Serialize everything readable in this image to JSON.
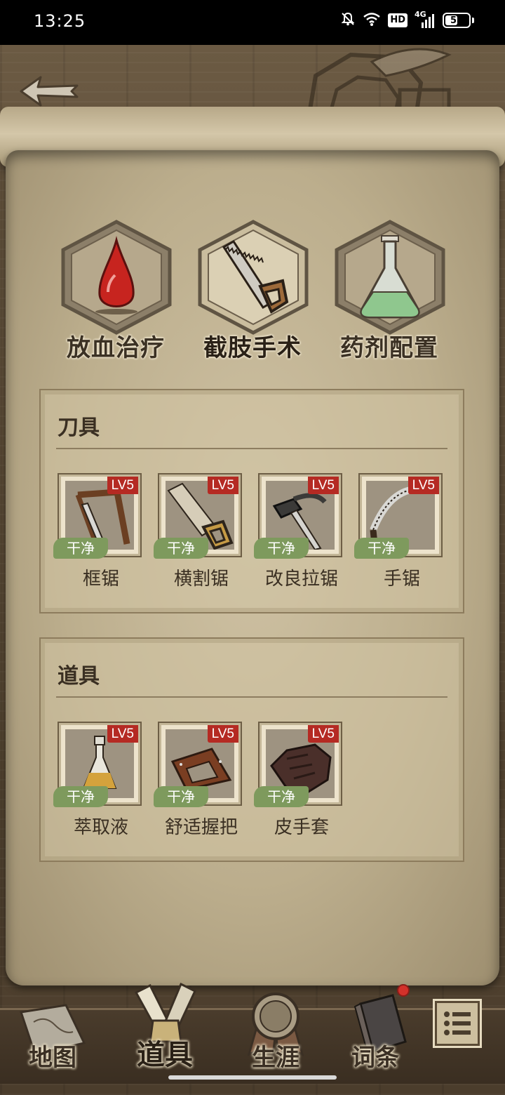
{
  "status_bar": {
    "time": "13:25",
    "network": "4G",
    "hd": "HD",
    "battery": "58",
    "battery_level": 0.58,
    "icons": [
      "mute-bell-icon",
      "wifi-icon",
      "hd-icon",
      "signal-icon",
      "battery-icon"
    ]
  },
  "header": {
    "back_icon": "arrow-left-icon"
  },
  "categories": [
    {
      "label": "放血治疗",
      "icon": "blood-drop-icon",
      "active": false
    },
    {
      "label": "截肢手术",
      "icon": "saw-icon",
      "active": true
    },
    {
      "label": "药剂配置",
      "icon": "flask-icon",
      "active": false
    }
  ],
  "sections": [
    {
      "title": "刀具",
      "items": [
        {
          "name": "框锯",
          "level": "LV5",
          "status": "干净",
          "icon": "frame-saw-icon"
        },
        {
          "name": "横割锯",
          "level": "LV5",
          "status": "干净",
          "icon": "crosscut-saw-icon"
        },
        {
          "name": "改良拉锯",
          "level": "LV5",
          "status": "干净",
          "icon": "pull-saw-icon"
        },
        {
          "name": "手锯",
          "level": "LV5",
          "status": "干净",
          "icon": "hand-saw-icon"
        }
      ]
    },
    {
      "title": "道具",
      "items": [
        {
          "name": "萃取液",
          "level": "LV5",
          "status": "干净",
          "icon": "extract-bottle-icon"
        },
        {
          "name": "舒适握把",
          "level": "LV5",
          "status": "干净",
          "icon": "comfort-grip-icon"
        },
        {
          "name": "皮手套",
          "level": "LV5",
          "status": "干净",
          "icon": "leather-glove-icon"
        }
      ]
    }
  ],
  "bottom_nav": [
    {
      "label": "地图",
      "icon": "map-icon",
      "active": false
    },
    {
      "label": "道具",
      "icon": "tools-icon",
      "active": true
    },
    {
      "label": "生涯",
      "icon": "medal-icon",
      "active": false
    },
    {
      "label": "词条",
      "icon": "book-icon",
      "active": false,
      "badge": true
    }
  ],
  "menu_icon": "menu-icon",
  "colors": {
    "level_badge": "#b52a23",
    "clean_tag": "#7e9a5d",
    "parchment": "#cfc2a4",
    "wood": "#5c4c37"
  }
}
